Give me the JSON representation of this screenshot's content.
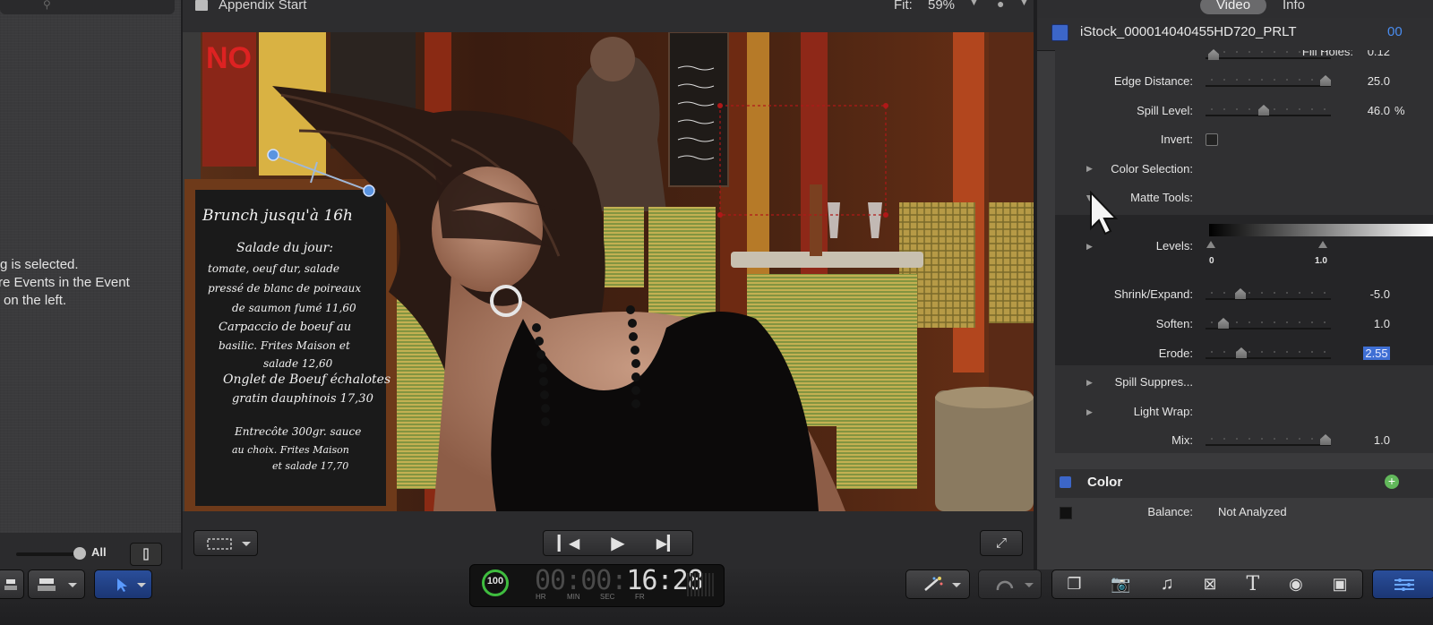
{
  "event_browser": {
    "message_lines": [
      "g is selected.",
      "re Events in the Event",
      "on the left."
    ],
    "filter_label": "All",
    "icons": [
      "search-icon",
      "clip-appearance-icon"
    ]
  },
  "viewer": {
    "title": "Appendix Start",
    "fit_label": "Fit:",
    "fit_value": "59%",
    "chalkboard_text": [
      "Brunch jusqu'à 16h",
      "Salade du jour:",
      "tomate, oeuf dur, salade",
      "pressé de blanc de poireaux",
      "de saumon fumé 11,60",
      "Carpaccio de boeuf au",
      "basilic. Frites Maison et",
      "salade 12,60",
      "Onglet de Boeuf échalotes",
      "gratin dauphinois 17,30",
      "Entrecôte 300gr. sauce",
      "au choix. Frites Maison",
      "et salade 17,70"
    ],
    "footer_icons": [
      "viewer-options-icon",
      "go-to-start-icon",
      "play-icon",
      "go-to-end-icon",
      "fullscreen-icon"
    ]
  },
  "inspector": {
    "tabs": [
      "Video",
      "Info"
    ],
    "active_tab": "Video",
    "clip_name": "iStock_000014040455HD720_PRLT",
    "clip_timecode_partial": "00",
    "keyer": {
      "fill_holes": {
        "label": "Fill Holes:",
        "value": "0.12",
        "level": 0.05
      },
      "edge_distance": {
        "label": "Edge Distance:",
        "value": "25.0",
        "level": 0.95
      },
      "spill_level": {
        "label": "Spill Level:",
        "value": "46.0",
        "unit": "%",
        "level": 0.46
      },
      "invert": {
        "label": "Invert:",
        "checked": false
      },
      "color_selection": {
        "label": "Color Selection:"
      },
      "matte_tools": {
        "label": "Matte Tools:"
      },
      "levels": {
        "label": "Levels:",
        "min_label": "0",
        "max_label": "1.0"
      },
      "shrink_expand": {
        "label": "Shrink/Expand:",
        "value": "-5.0",
        "level": 0.27
      },
      "soften": {
        "label": "Soften:",
        "value": "1.0",
        "level": 0.13
      },
      "erode": {
        "label": "Erode:",
        "value": "2.55",
        "level": 0.28
      },
      "spill_suppress": {
        "label": "Spill Suppres..."
      },
      "light_wrap": {
        "label": "Light Wrap:"
      },
      "mix": {
        "label": "Mix:",
        "value": "1.0",
        "level": 0.95
      }
    },
    "color": {
      "title": "Color",
      "balance_label": "Balance:",
      "balance_value": "Not Analyzed"
    }
  },
  "toolbar": {
    "background_tasks_percent": "100",
    "timecode": {
      "hr": "00",
      "min": "00",
      "sec": "16",
      "fr": "28"
    },
    "timecode_labels": [
      "HR",
      "MIN",
      "SEC",
      "FR"
    ],
    "icons": [
      "connect-clip-icon",
      "append-clip-icon",
      "select-arrow-icon",
      "enhancements-wand-icon",
      "retime-icon",
      "effects-browser-icon",
      "photos-browser-icon",
      "music-browser-icon",
      "transitions-browser-icon",
      "titles-browser-icon",
      "generators-browser-icon",
      "themes-browser-icon",
      "inspector-toggle-icon"
    ]
  },
  "colors": {
    "accent_blue": "#3f6fd4",
    "progress_green": "#3fbd3f",
    "panel": "#3a3a3c"
  }
}
